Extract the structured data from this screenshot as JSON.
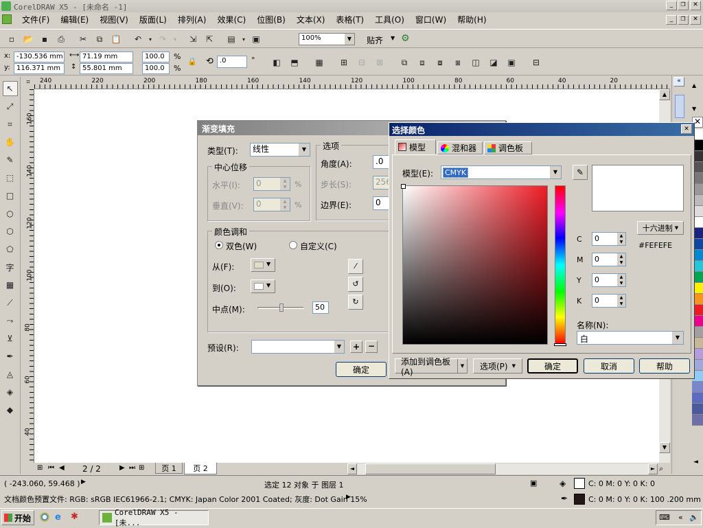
{
  "app": {
    "title": "CorelDRAW X5 - [未命名 -1]",
    "menus": [
      "文件(F)",
      "编辑(E)",
      "视图(V)",
      "版面(L)",
      "排列(A)",
      "效果(C)",
      "位图(B)",
      "文本(X)",
      "表格(T)",
      "工具(O)",
      "窗口(W)",
      "帮助(H)"
    ]
  },
  "toolbar": {
    "zoom": "100%",
    "snap_label": "贴齐"
  },
  "propbar": {
    "x": "-130.536 mm",
    "y": "116.371 mm",
    "w": "71.19 mm",
    "h": "55.801 mm",
    "sx": "100.0",
    "sy": "100.0",
    "pct": "%",
    "angle": ".0",
    "deg": "°"
  },
  "rulers": {
    "h_ticks": [
      "240",
      "220",
      "200",
      "180",
      "160",
      "140",
      "120",
      "100",
      "80",
      "60",
      "40",
      "20"
    ],
    "v_ticks": [
      "160",
      "140",
      "120",
      "100",
      "80",
      "60",
      "40"
    ]
  },
  "pages": {
    "counter": "2 / 2",
    "tabs": [
      "页 1",
      "页 2"
    ]
  },
  "gradient_dialog": {
    "title": "渐变填充",
    "type_label": "类型(T):",
    "type_value": "线性",
    "center_offset": "中心位移",
    "h_label": "水平(I):",
    "v_label": "垂直(V):",
    "h_value": "0",
    "v_value": "0",
    "pct": "%",
    "options": "选项",
    "angle_label": "角度(A):",
    "angle_value": ".0",
    "steps_label": "步长(S):",
    "steps_value": "256",
    "edge_label": "边界(E):",
    "edge_value": "0",
    "blend": "颜色调和",
    "two_color": "双色(W)",
    "custom": "自定义(C)",
    "from": "从(F):",
    "to": "到(O):",
    "mid": "中点(M):",
    "mid_value": "50",
    "preset": "预设(R):",
    "ok": "确定"
  },
  "color_dialog": {
    "title": "选择颜色",
    "tabs": [
      "模型",
      "混和器",
      "调色板"
    ],
    "model_label": "模型(E):",
    "model_value": "CMYK",
    "hex_mode": "十六进制",
    "hex_value": "#FEFEFE",
    "channels": [
      {
        "label": "C",
        "value": "0"
      },
      {
        "label": "M",
        "value": "0"
      },
      {
        "label": "Y",
        "value": "0"
      },
      {
        "label": "K",
        "value": "0"
      }
    ],
    "name_label": "名称(N):",
    "name_value": "白",
    "add_palette": "添加到调色板(A)",
    "options": "选项(P)",
    "ok": "确定",
    "cancel": "取消",
    "help": "帮助"
  },
  "status": {
    "coords": "( -243.060, 59.468 )",
    "selection": "选定 12 对象 于 图层 1",
    "profile": "文档颜色预置文件: RGB: sRGB IEC61966-2.1; CMYK: Japan Color 2001 Coated; 灰度: Dot Gain 15%",
    "fill": "C: 0 M: 0 Y: 0 K: 0",
    "outline": "C: 0 M: 0 Y: 0 K: 100  .200 mm"
  },
  "taskbar": {
    "start": "开始",
    "task": "CorelDRAW X5 - [未..."
  },
  "colors": {
    "palette": [
      "#ffffff",
      "#000000",
      "#333333",
      "#555555",
      "#777777",
      "#999999",
      "#bbbbbb",
      "#dddddd",
      "#ffffff",
      "#1a237e",
      "#0d47a1",
      "#0288d1",
      "#26c6da",
      "#00a651",
      "#fff200",
      "#f7941d",
      "#ed1c24",
      "#ec008c",
      "#a0a0a0",
      "#c8b89a",
      "#b39ddb",
      "#9fa8da",
      "#90caf9",
      "#7986cb",
      "#5c6bc0",
      "#4a5a9a",
      "#6f6fa8"
    ]
  }
}
